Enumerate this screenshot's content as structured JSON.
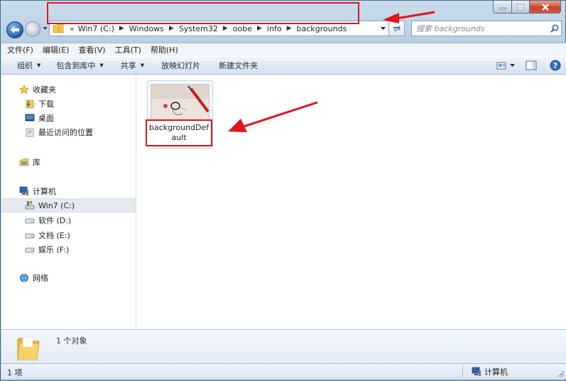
{
  "window": {
    "title": ""
  },
  "nav": {
    "breadcrumb_overflow": "«",
    "breadcrumb": [
      "Win7 (C:)",
      "Windows",
      "System32",
      "oobe",
      "info",
      "backgrounds"
    ],
    "search_placeholder": "搜索 backgrounds"
  },
  "menubar": [
    "文件(F)",
    "编辑(E)",
    "查看(V)",
    "工具(T)",
    "帮助(H)"
  ],
  "toolbar": {
    "organize": "组织",
    "include_in_library": "包含到库中",
    "share": "共享",
    "slideshow": "放映幻灯片",
    "new_folder": "新建文件夹"
  },
  "navpane": {
    "favorites": {
      "label": "收藏夹",
      "items": [
        "下载",
        "桌面",
        "最近访问的位置"
      ]
    },
    "libraries": {
      "label": "库"
    },
    "computer": {
      "label": "计算机",
      "items": [
        "Win7 (C:)",
        "软件 (D:)",
        "文档 (E:)",
        "娱乐 (F:)"
      ],
      "selected": "Win7 (C:)"
    },
    "network": {
      "label": "网络"
    }
  },
  "files": [
    {
      "name": "backgroundDefault",
      "type": "image"
    }
  ],
  "details": {
    "count": "1 个对象"
  },
  "status": {
    "items": "1 项",
    "location": "计算机"
  },
  "colors": {
    "highlight": "#e0141b",
    "selection": "#e5eaf0",
    "window_frame": "#b9d0e4"
  }
}
